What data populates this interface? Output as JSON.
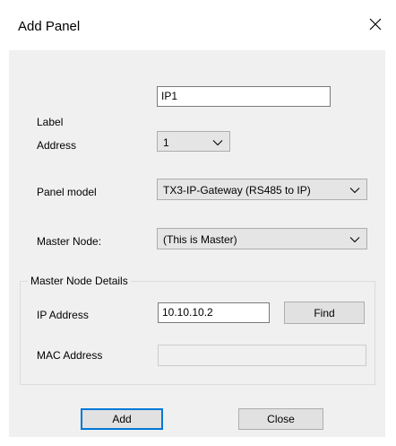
{
  "window": {
    "title": "Add Panel",
    "close_icon": "close-icon"
  },
  "form": {
    "label": {
      "caption": "Label",
      "value": "IP1"
    },
    "address": {
      "caption": "Address",
      "selected": "1"
    },
    "panel_model": {
      "caption": "Panel model",
      "selected": "TX3-IP-Gateway (RS485 to IP)"
    },
    "master_node": {
      "caption": "Master Node:",
      "selected": "(This is Master)"
    }
  },
  "master_details": {
    "title": "Master Node Details",
    "ip_caption": "IP Address",
    "ip_value": "10.10.10.2",
    "find_label": "Find",
    "mac_caption": "MAC Address",
    "mac_value": ""
  },
  "footer": {
    "add_label": "Add",
    "close_label": "Close"
  },
  "colors": {
    "accent": "#0078d7",
    "dialog_bg": "#f0f0f0"
  }
}
